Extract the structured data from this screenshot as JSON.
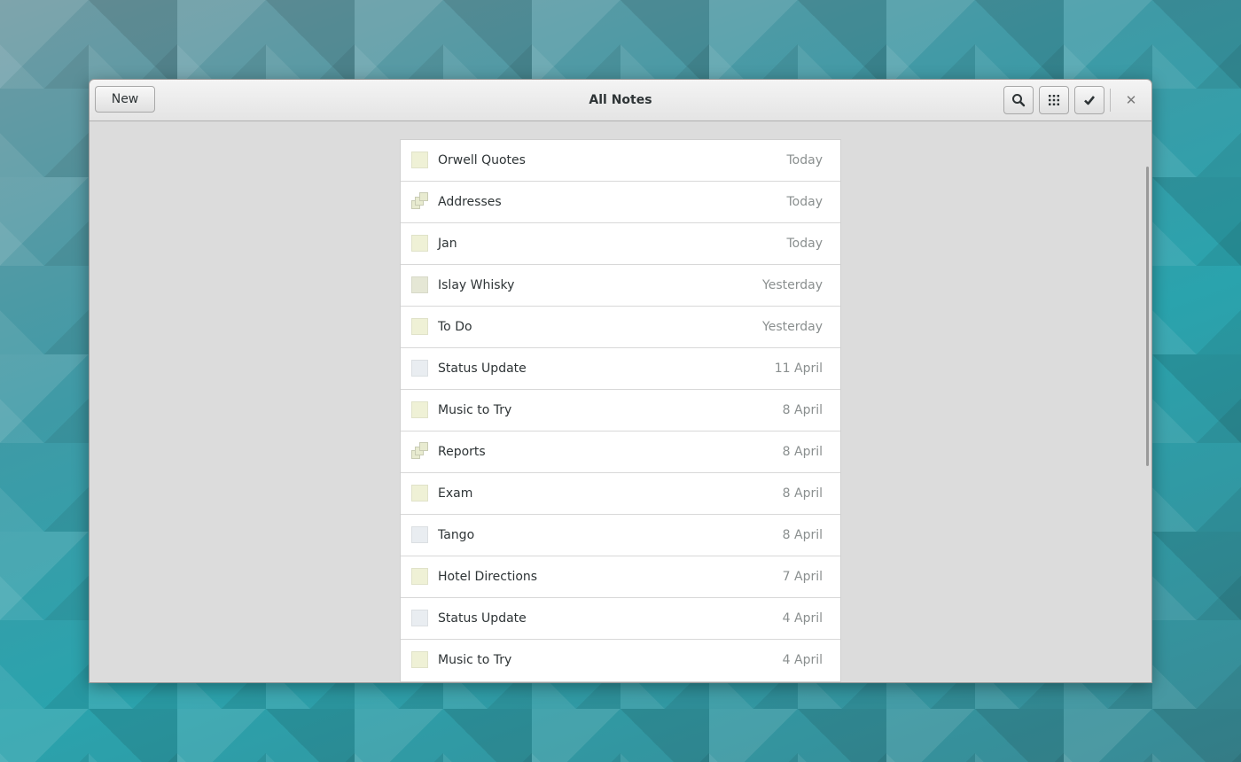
{
  "window": {
    "title": "All Notes",
    "new_label": "New",
    "close_glyph": "✕"
  },
  "toolbar": {
    "search_icon": "search-icon",
    "grid_icon": "grid-view-icon",
    "select_icon": "checkmark-icon"
  },
  "notes": [
    {
      "title": "Orwell Quotes",
      "date": "Today",
      "kind": "note",
      "color": "#eff1d6"
    },
    {
      "title": "Addresses",
      "date": "Today",
      "kind": "collection",
      "color": "#e8ebd0"
    },
    {
      "title": "Jan",
      "date": "Today",
      "kind": "note",
      "color": "#eff1d6"
    },
    {
      "title": "Islay Whisky",
      "date": "Yesterday",
      "kind": "note",
      "color": "#e5e7d5"
    },
    {
      "title": "To Do",
      "date": "Yesterday",
      "kind": "note",
      "color": "#eff1d6"
    },
    {
      "title": "Status Update",
      "date": "11 April",
      "kind": "note",
      "color": "#e9edf1"
    },
    {
      "title": "Music to Try",
      "date": "8 April",
      "kind": "note",
      "color": "#eff1d6"
    },
    {
      "title": "Reports",
      "date": "8 April",
      "kind": "collection",
      "color": "#e8ebd0"
    },
    {
      "title": "Exam",
      "date": "8 April",
      "kind": "note",
      "color": "#eff1d6"
    },
    {
      "title": "Tango",
      "date": "8 April",
      "kind": "note",
      "color": "#e9edf1"
    },
    {
      "title": "Hotel Directions",
      "date": "7 April",
      "kind": "note",
      "color": "#eff1d6"
    },
    {
      "title": "Status Update",
      "date": "4 April",
      "kind": "note",
      "color": "#e9edf1"
    },
    {
      "title": "Music to Try",
      "date": "4 April",
      "kind": "note",
      "color": "#eff1d6"
    }
  ]
}
